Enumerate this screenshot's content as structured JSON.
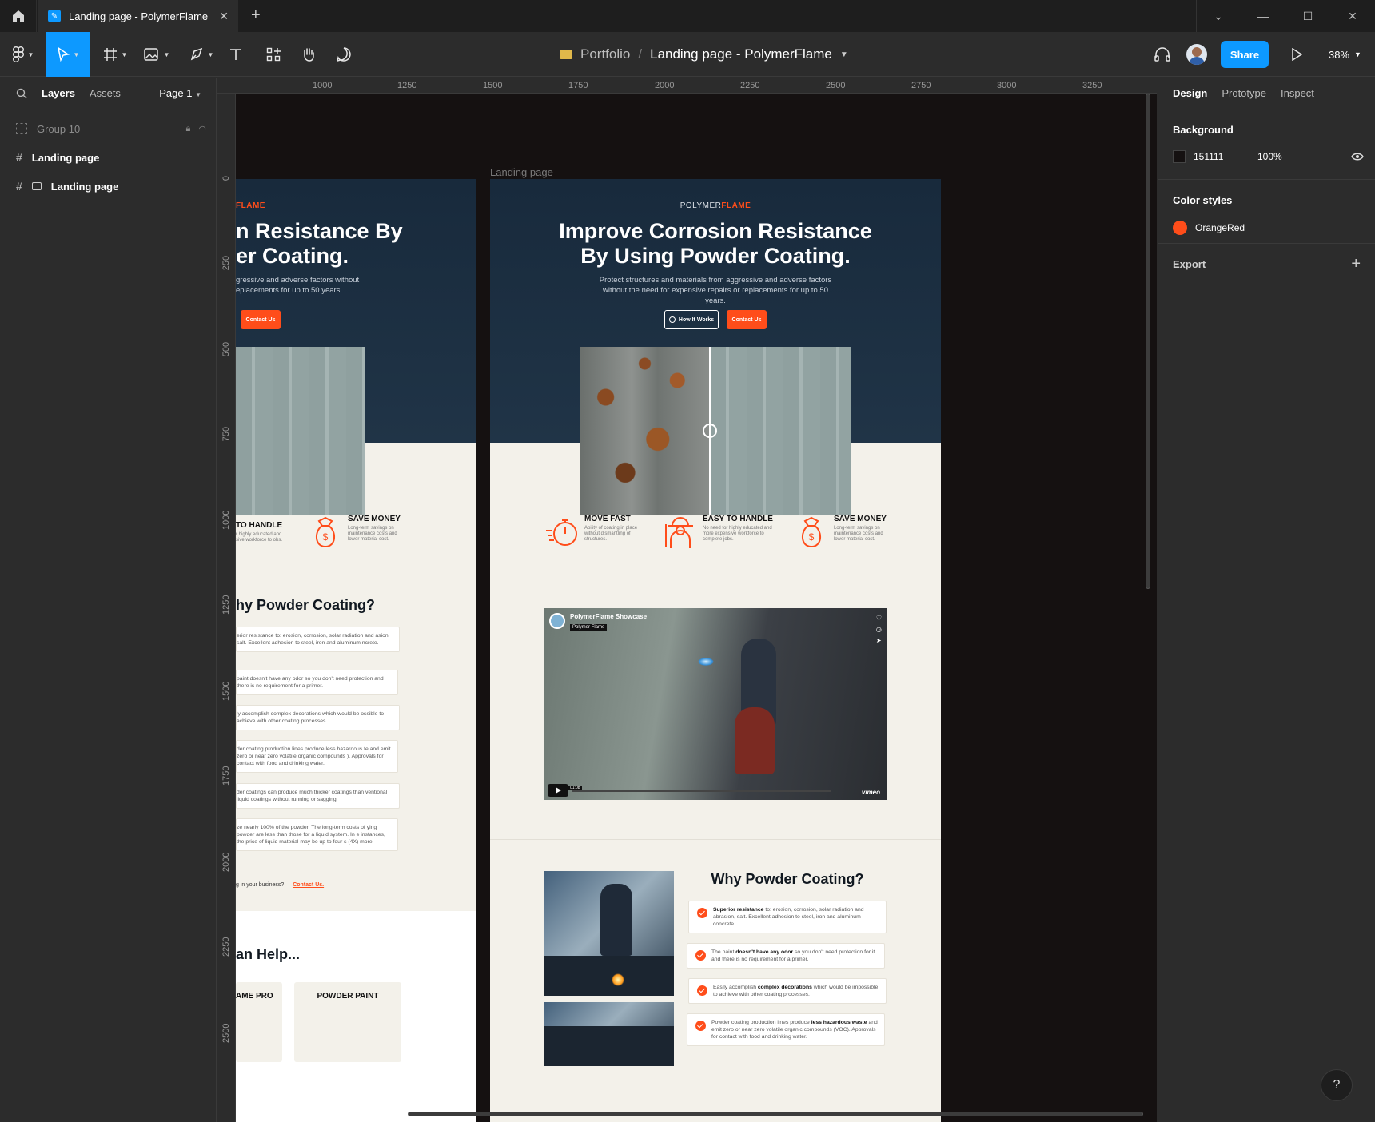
{
  "titlebar": {
    "tab_title": "Landing page - PolymerFlame"
  },
  "toolbar": {
    "project": "Portfolio",
    "separator": "/",
    "file_name": "Landing page - PolymerFlame",
    "share_label": "Share",
    "zoom": "38%"
  },
  "left_panel": {
    "tabs": [
      "Layers",
      "Assets"
    ],
    "page": "Page 1",
    "layers": [
      {
        "name": "Group 10",
        "icon": "group-icon"
      },
      {
        "name": "Landing page",
        "icon": "frame-icon"
      },
      {
        "name": "Landing page",
        "icon": "section-icon"
      }
    ]
  },
  "rulers": {
    "top": [
      "1000",
      "1250",
      "1500",
      "1750",
      "2000",
      "2250",
      "2500",
      "2750",
      "3000",
      "3250"
    ],
    "left": [
      "0",
      "250",
      "500",
      "750",
      "1000",
      "1250",
      "1500",
      "1750",
      "2000",
      "2250",
      "2500"
    ]
  },
  "canvas": {
    "frame_label": "Landing page",
    "background": "#151111",
    "brand_prefix": "POLYMER",
    "brand_suffix": "FLAME",
    "hero_title": "Improve Corrosion Resistance By Using Powder Coating.",
    "hero_sub": "Protect structures and materials from aggressive and adverse factors without the need for expensive repairs or replacements for up to 50 years.",
    "btn_how": "How It Works",
    "btn_contact": "Contact Us",
    "left_frame": {
      "title_line1": "n Resistance By",
      "title_line2": "er Coating.",
      "sub_line1": "gressive and adverse factors without",
      "sub_line2": "eplacements for up to 50 years.",
      "feat2_title": "TO HANDLE",
      "feat2_text": "r highly educated and sive workforce to obs.",
      "why_title": "hy Powder Coating?",
      "cards": [
        "erior resistance to: erosion, corrosion, solar radiation and asion, salt. Excellent adhesion to steel, iron and aluminum ncrete.",
        "paint doesn't have any odor so you don't need protection and there is no requirement for a primer.",
        "ly accomplish complex decorations which would be ossible to achieve with other coating processes.",
        "der coating production lines produce less hazardous te and emit zero or near zero volatile organic compounds ). Approvals for contact with food and drinking water.",
        "der coatings can produce much thicker coatings than ventional liquid coatings without running or sagging.",
        "ze nearly 100% of the powder. The long-term costs of ying powder are less than those for a liquid system. In e instances, the price of liquid material may be up to four s (4X) more."
      ],
      "cta_text": "g in your business? — ",
      "cta_link": "Contact Us.",
      "help_title": "an Help...",
      "product1": "AME PRO",
      "product2": "POWDER PAINT"
    },
    "features": [
      {
        "title": "MOVE FAST",
        "text": "Ability of coating in place without dismantling of structures.",
        "icon": "stopwatch-icon"
      },
      {
        "title": "EASY TO HANDLE",
        "text": "No need for highly educated and more expensive workforce to complete jobs.",
        "icon": "worker-icon"
      },
      {
        "title": "SAVE MONEY",
        "text": "Long-term savings on maintenance costs and lower material cost.",
        "icon": "money-bag-icon"
      }
    ],
    "video": {
      "title": "PolymerFlame Showcase",
      "badge": "Polymer Flame",
      "brand": "vimeo",
      "time": "01:08"
    },
    "why_title": "Why Powder Coating?",
    "cards": [
      {
        "bold": "Superior resistance",
        "text": " to: erosion, corrosion, solar radiation and abrasion, salt. Excellent adhesion to steel, iron and aluminum concrete.",
        "pre": ""
      },
      {
        "pre": "The paint ",
        "bold": "doesn't have any odor",
        "text": " so you don't need protection for it and there is no requirement for a primer."
      },
      {
        "pre": "Easily accomplish ",
        "bold": "complex decorations",
        "text": " which would be impossible to achieve with other coating processes."
      },
      {
        "pre": "Powder coating production lines produce ",
        "bold": "less hazardous waste",
        "text": " and emit zero or near zero volatile organic compounds (VOC). Approvals for contact with food and drinking water."
      }
    ]
  },
  "right_panel": {
    "tabs": [
      "Design",
      "Prototype",
      "Inspect"
    ],
    "background_heading": "Background",
    "bg_hex": "151111",
    "bg_opacity": "100%",
    "color_styles_heading": "Color styles",
    "color_style_name": "OrangeRed",
    "color_style_value": "#ff4d1a",
    "export_heading": "Export"
  },
  "help_label": "?"
}
